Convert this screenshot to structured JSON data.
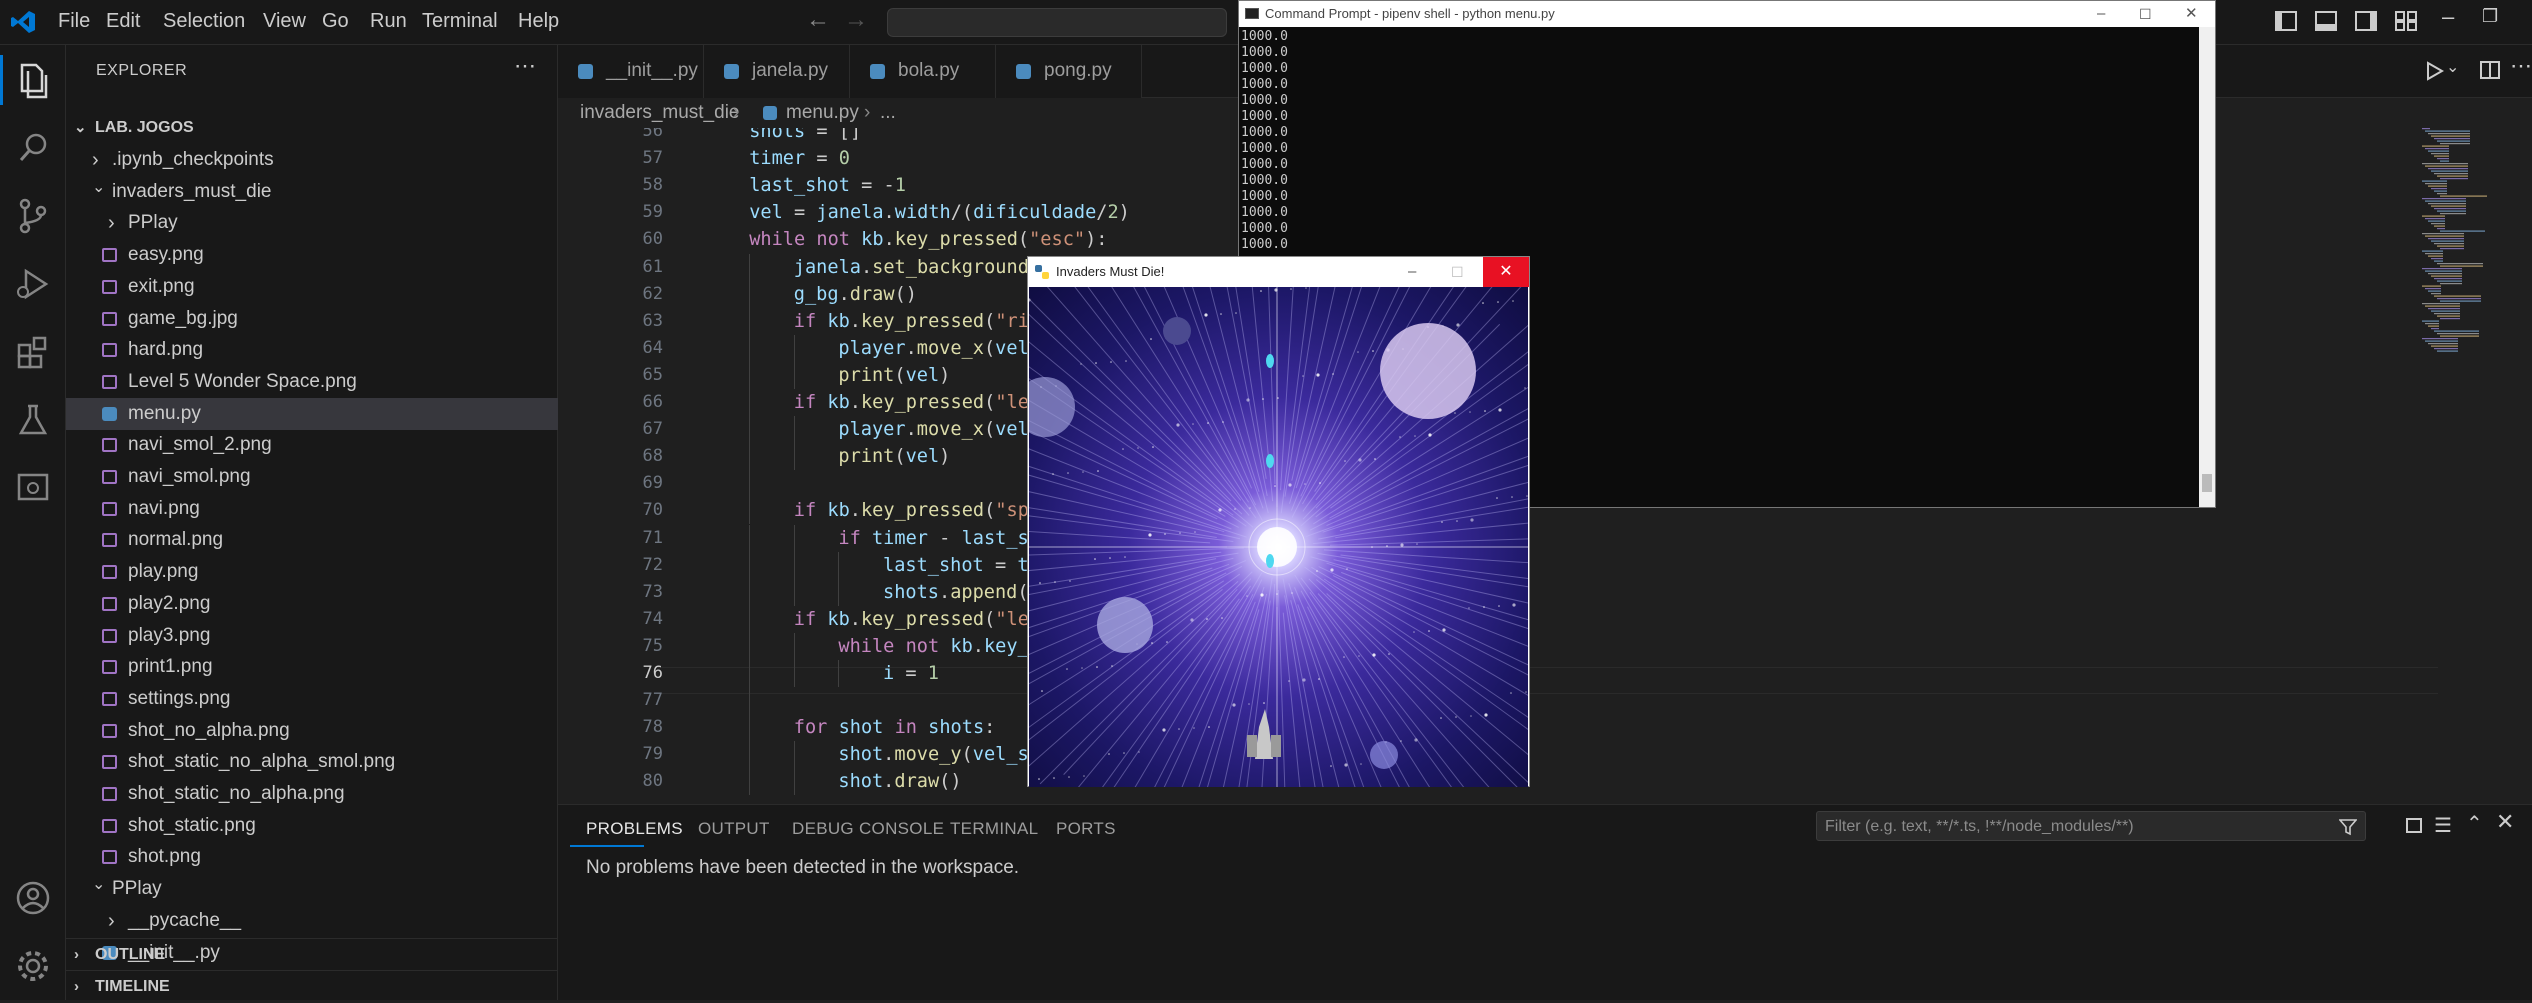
{
  "titlebar": {
    "menus": [
      "File",
      "Edit",
      "Selection",
      "View",
      "Go",
      "Run",
      "Terminal",
      "Help"
    ]
  },
  "activity": {
    "icons": [
      "explorer-icon",
      "search-icon",
      "source-control-icon",
      "run-debug-icon",
      "extensions-icon",
      "testing-icon",
      "remote-explorer-icon",
      "accounts-icon",
      "manage-gear-icon"
    ]
  },
  "explorer": {
    "title": "EXPLORER",
    "root": "LAB. JOGOS",
    "items": [
      {
        "label": ".ipynb_checkpoints",
        "kind": "folder",
        "depth": 1,
        "open": false
      },
      {
        "label": "invaders_must_die",
        "kind": "folder",
        "depth": 1,
        "open": true
      },
      {
        "label": "PPlay",
        "kind": "folder",
        "depth": 2,
        "open": false
      },
      {
        "label": "easy.png",
        "kind": "image",
        "depth": 2
      },
      {
        "label": "exit.png",
        "kind": "image",
        "depth": 2
      },
      {
        "label": "game_bg.jpg",
        "kind": "image",
        "depth": 2
      },
      {
        "label": "hard.png",
        "kind": "image",
        "depth": 2
      },
      {
        "label": "Level 5 Wonder Space.png",
        "kind": "image",
        "depth": 2
      },
      {
        "label": "menu.py",
        "kind": "python",
        "depth": 2,
        "selected": true
      },
      {
        "label": "navi_smol_2.png",
        "kind": "image",
        "depth": 2
      },
      {
        "label": "navi_smol.png",
        "kind": "image",
        "depth": 2
      },
      {
        "label": "navi.png",
        "kind": "image",
        "depth": 2
      },
      {
        "label": "normal.png",
        "kind": "image",
        "depth": 2
      },
      {
        "label": "play.png",
        "kind": "image",
        "depth": 2
      },
      {
        "label": "play2.png",
        "kind": "image",
        "depth": 2
      },
      {
        "label": "play3.png",
        "kind": "image",
        "depth": 2
      },
      {
        "label": "print1.png",
        "kind": "image",
        "depth": 2
      },
      {
        "label": "settings.png",
        "kind": "image",
        "depth": 2
      },
      {
        "label": "shot_no_alpha.png",
        "kind": "image",
        "depth": 2
      },
      {
        "label": "shot_static_no_alpha_smol.png",
        "kind": "image",
        "depth": 2
      },
      {
        "label": "shot_static_no_alpha.png",
        "kind": "image",
        "depth": 2
      },
      {
        "label": "shot_static.png",
        "kind": "image",
        "depth": 2
      },
      {
        "label": "shot.png",
        "kind": "image",
        "depth": 2
      },
      {
        "label": "PPlay",
        "kind": "folder",
        "depth": 1,
        "open": true
      },
      {
        "label": "__pycache__",
        "kind": "folder",
        "depth": 2,
        "open": false
      },
      {
        "label": "__init__.py",
        "kind": "python",
        "depth": 2
      }
    ],
    "outline": "OUTLINE",
    "timeline": "TIMELINE"
  },
  "tabs": [
    "__init__.py",
    "janela.py",
    "bola.py",
    "pong.py"
  ],
  "breadcrumb": {
    "folder": "invaders_must_die",
    "file": "menu.py",
    "rest": "..."
  },
  "editor": {
    "current_line": 76,
    "lines": [
      {
        "n": 56,
        "indent": 2,
        "text": "shots = []"
      },
      {
        "n": 57,
        "indent": 2,
        "text": "timer = 0"
      },
      {
        "n": 58,
        "indent": 2,
        "text": "last_shot = -1"
      },
      {
        "n": 59,
        "indent": 2,
        "text": "vel = janela.width/(dificuldade/2)"
      },
      {
        "n": 60,
        "indent": 2,
        "text": "while not kb.key_pressed(\"esc\"):"
      },
      {
        "n": 61,
        "indent": 3,
        "text": "janela.set_background_"
      },
      {
        "n": 62,
        "indent": 3,
        "text": "g_bg.draw()"
      },
      {
        "n": 63,
        "indent": 3,
        "text": "if kb.key_pressed(\"rig"
      },
      {
        "n": 64,
        "indent": 4,
        "text": "player.move_x(vel*"
      },
      {
        "n": 65,
        "indent": 4,
        "text": "print(vel)"
      },
      {
        "n": 66,
        "indent": 3,
        "text": "if kb.key_pressed(\"lef"
      },
      {
        "n": 67,
        "indent": 4,
        "text": "player.move_x(vel*"
      },
      {
        "n": 68,
        "indent": 4,
        "text": "print(vel)"
      },
      {
        "n": 69,
        "indent": 3,
        "text": ""
      },
      {
        "n": 70,
        "indent": 3,
        "text": "if kb.key_pressed(\"spa"
      },
      {
        "n": 71,
        "indent": 4,
        "text": "if timer - last_sh"
      },
      {
        "n": 72,
        "indent": 5,
        "text": "last_shot = ti"
      },
      {
        "n": 73,
        "indent": 5,
        "text": "shots.append(S"
      },
      {
        "n": 74,
        "indent": 3,
        "text": "if kb.key_pressed(\"lef"
      },
      {
        "n": 75,
        "indent": 4,
        "text": "while not kb.key_p"
      },
      {
        "n": 76,
        "indent": 5,
        "text": "i = 1"
      },
      {
        "n": 77,
        "indent": 3,
        "text": ""
      },
      {
        "n": 78,
        "indent": 3,
        "text": "for shot in shots:"
      },
      {
        "n": 79,
        "indent": 4,
        "text": "shot.move_y(vel_sh"
      },
      {
        "n": 80,
        "indent": 4,
        "text": "shot.draw()"
      }
    ]
  },
  "panel": {
    "tabs": [
      "PROBLEMS",
      "OUTPUT",
      "DEBUG CONSOLE",
      "TERMINAL",
      "PORTS"
    ],
    "active": "PROBLEMS",
    "message": "No problems have been detected in the workspace.",
    "filter_placeholder": "Filter (e.g. text, **/*.ts, !**/node_modules/**)"
  },
  "cmd": {
    "title": "Command Prompt - pipenv  shell - python  menu.py",
    "output": [
      "1000.0",
      "1000.0",
      "1000.0",
      "1000.0",
      "1000.0",
      "1000.0",
      "1000.0",
      "1000.0",
      "1000.0",
      "1000.0",
      "1000.0",
      "1000.0",
      "1000.0",
      "1000.0"
    ]
  },
  "game": {
    "title": "Invaders Must Die!"
  },
  "colors": {
    "accent": "#0078d4",
    "close_red": "#e81123",
    "keyword": "#c586c0",
    "function": "#dcdcaa",
    "string": "#ce9178",
    "number": "#b5cea8",
    "variable": "#9cdcfe"
  }
}
